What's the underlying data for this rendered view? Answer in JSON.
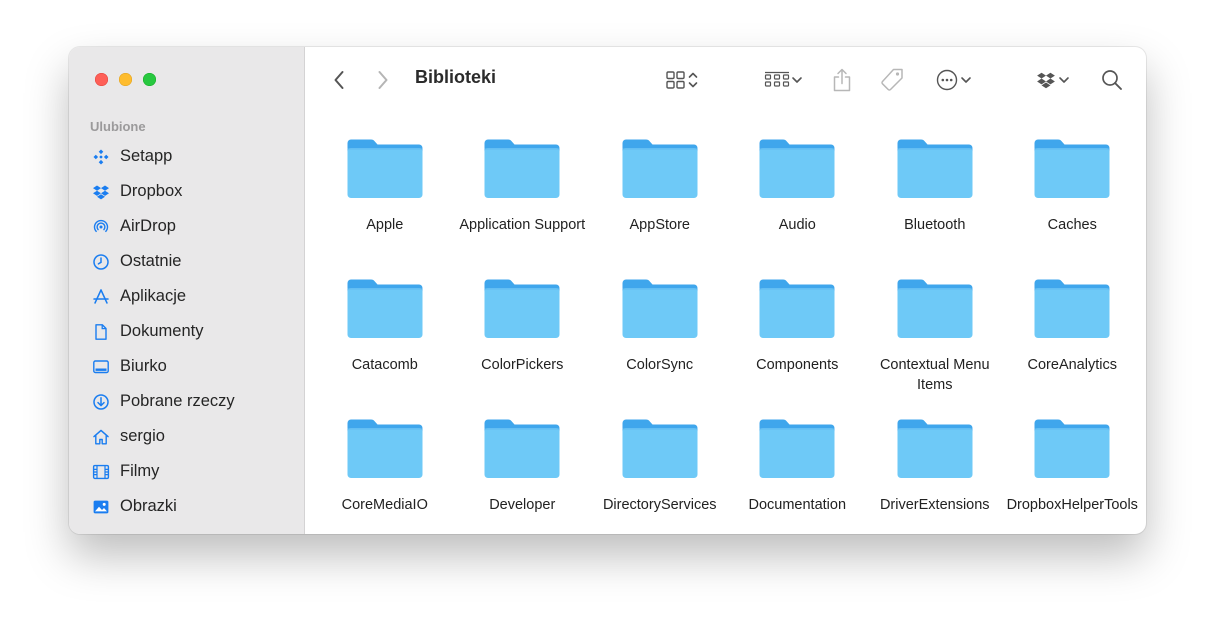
{
  "window": {
    "title": "Biblioteki"
  },
  "sidebar": {
    "section_title": "Ulubione",
    "items": [
      {
        "label": "Setapp",
        "icon": "setapp-icon"
      },
      {
        "label": "Dropbox",
        "icon": "dropbox-icon"
      },
      {
        "label": "AirDrop",
        "icon": "airdrop-icon"
      },
      {
        "label": "Ostatnie",
        "icon": "clock-icon"
      },
      {
        "label": "Aplikacje",
        "icon": "applications-icon"
      },
      {
        "label": "Dokumenty",
        "icon": "document-icon"
      },
      {
        "label": "Biurko",
        "icon": "desktop-icon"
      },
      {
        "label": "Pobrane rzeczy",
        "icon": "download-icon"
      },
      {
        "label": "sergio",
        "icon": "home-icon"
      },
      {
        "label": "Filmy",
        "icon": "film-icon"
      },
      {
        "label": "Obrazki",
        "icon": "photo-icon"
      }
    ]
  },
  "toolbar": {
    "icons": [
      "back-icon",
      "forward-icon",
      "icon-view-icon",
      "group-icon",
      "share-icon",
      "tag-icon",
      "more-icon",
      "dropbox-icon",
      "search-icon"
    ]
  },
  "folders": [
    "Apple",
    "Application Support",
    "AppStore",
    "Audio",
    "Bluetooth",
    "Caches",
    "Catacomb",
    "ColorPickers",
    "ColorSync",
    "Components",
    "Contextual Menu Items",
    "CoreAnalytics",
    "CoreMediaIO",
    "Developer",
    "DirectoryServices",
    "Documentation",
    "DriverExtensions",
    "DropboxHelperTools"
  ],
  "colors": {
    "accent": "#1a7df0",
    "folder_body": "#6ec9f7",
    "folder_tab": "#3fa6ec",
    "sidebar_bg": "#e9e8e9"
  }
}
